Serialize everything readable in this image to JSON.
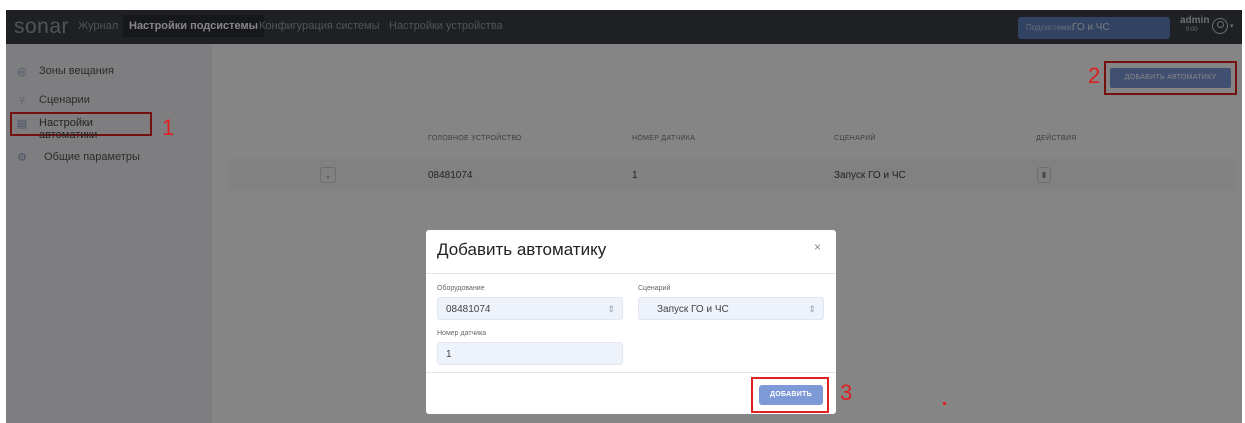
{
  "topbar": {
    "logo": "sonar",
    "nav": [
      "Журнал",
      "Настройки подсистемы",
      "Конфигурация системы",
      "Настройки устройства"
    ],
    "subsystem_label": "Подсистема:",
    "subsystem_value": "ГО и ЧС",
    "user_name": "admin",
    "user_time": "0:00"
  },
  "sidebar": {
    "items": [
      {
        "label": "Зоны вещания",
        "icon": "broadcast-icon"
      },
      {
        "label": "Сценарии",
        "icon": "branch-icon"
      },
      {
        "label": "Настройки автоматики",
        "icon": "toggle-icon"
      },
      {
        "label": "Общие параметры",
        "icon": "gear-icon"
      }
    ]
  },
  "annotations": {
    "n1": "1",
    "n2": "2",
    "n3": "3"
  },
  "main": {
    "add_button": "ДОБАВИТЬ АВТОМАТИКУ",
    "columns": [
      "ГОЛОВНОЕ УСТРОЙСТВО",
      "НОМЕР ДАТЧИКА",
      "СЦЕНАРИЙ",
      "ДЕЙСТВИЯ"
    ],
    "rows": [
      {
        "device": "08481074",
        "sensor": "1",
        "scenario": "Запуск ГО и ЧС"
      }
    ]
  },
  "modal": {
    "title": "Добавить автоматику",
    "close": "×",
    "equipment_label": "Оборудование",
    "equipment_value": "08481074",
    "scenario_label": "Сценарий",
    "scenario_value": "Запуск ГО и ЧС",
    "sensor_label": "Номер датчика",
    "sensor_value": "1",
    "submit": "ДОБАВИТЬ"
  },
  "colors": {
    "accent": "#7d9ad6",
    "annotation": "#e02020",
    "topbar": "#3b3e45"
  }
}
